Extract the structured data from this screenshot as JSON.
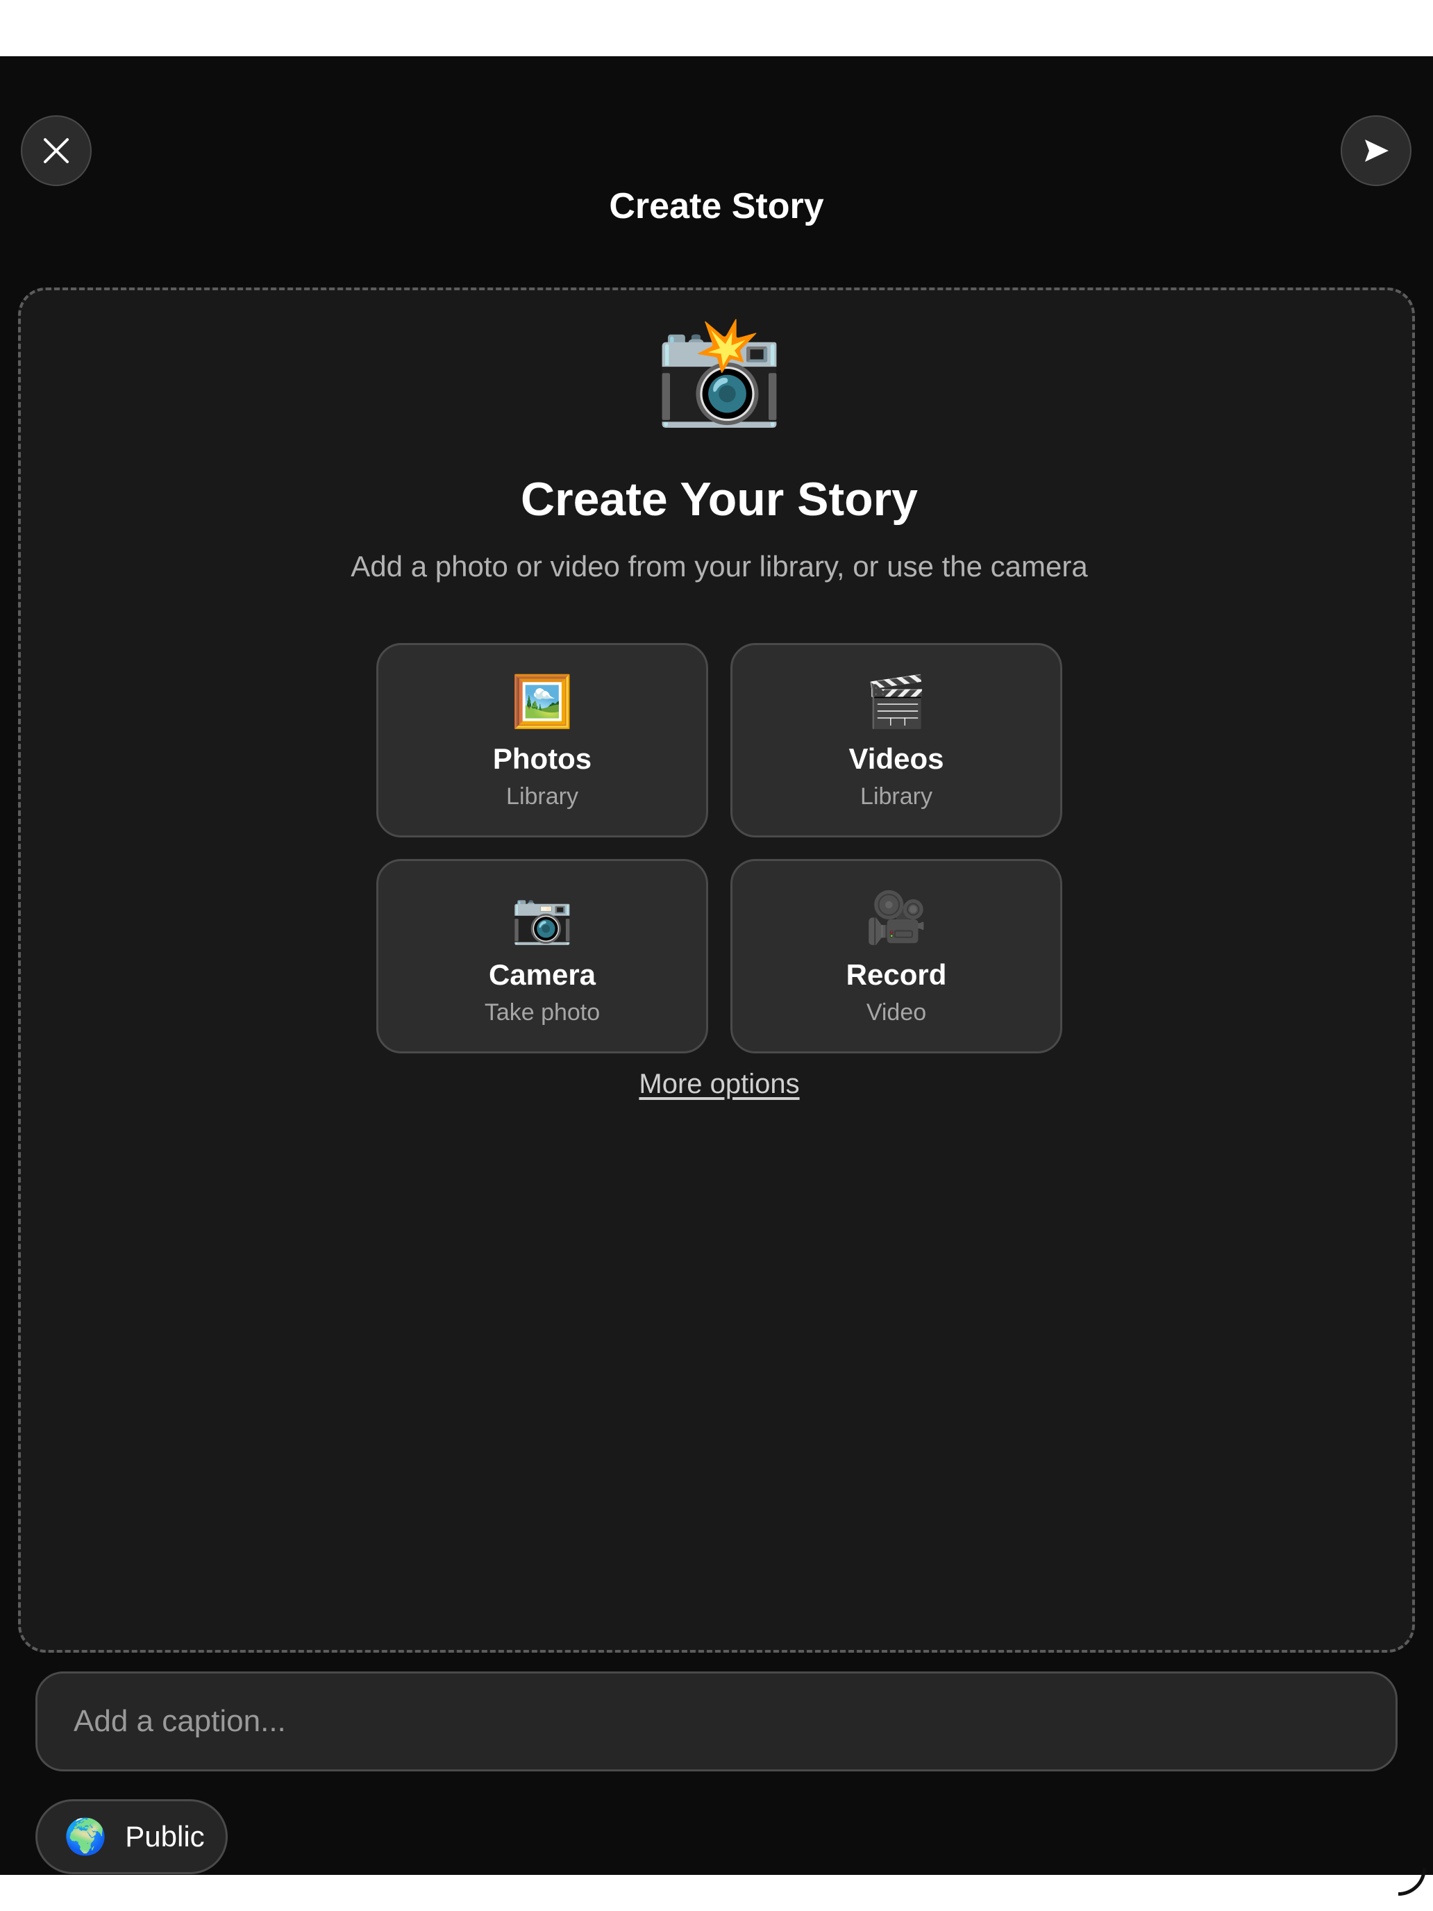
{
  "header": {
    "title": "Create Story",
    "close_icon": "close-icon",
    "send_icon": "send-arrow-icon"
  },
  "hero": {
    "icon": "📸",
    "title": "Create Your Story",
    "subtitle": "Add a photo or video from your library, or use the camera"
  },
  "options": [
    {
      "icon": "🖼️",
      "label": "Photos",
      "sublabel": "Library"
    },
    {
      "icon": "🎬",
      "label": "Videos",
      "sublabel": "Library"
    },
    {
      "icon": "📷",
      "label": "Camera",
      "sublabel": "Take photo"
    },
    {
      "icon": "🎥",
      "label": "Record",
      "sublabel": "Video"
    }
  ],
  "more_options": "More options",
  "caption": {
    "placeholder": "Add a caption...",
    "value": ""
  },
  "privacy": {
    "icon": "🌍",
    "label": "Public"
  },
  "colors": {
    "background": "#0c0c0c",
    "dropzone": "#191919",
    "tile": "#2d2d2d",
    "border": "#4a4a4a",
    "text_primary": "#ffffff",
    "text_secondary": "#a6a6a6"
  }
}
